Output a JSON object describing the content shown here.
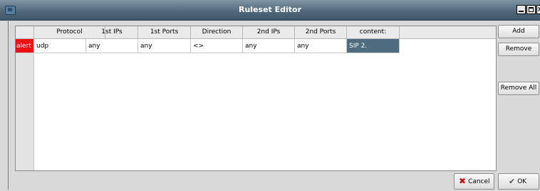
{
  "window": {
    "title": "Ruleset Editor"
  },
  "table": {
    "columns": [
      "Protocol",
      "1st IPs",
      "1st Ports",
      "Direction",
      "2nd IPs",
      "2nd Ports",
      "content:"
    ],
    "rows": [
      {
        "action": "alert",
        "protocol": "udp",
        "ips1": "any",
        "ports1": "any",
        "direction": "<>",
        "ips2": "any",
        "ports2": "any",
        "content": "SIP 2."
      }
    ]
  },
  "buttons": {
    "add": "Add",
    "remove": "Remove",
    "remove_all": "Remove All",
    "cancel": "Cancel",
    "ok": "OK"
  },
  "colors": {
    "action_cell": "#ee1111",
    "selected_cell": "#4e6b80",
    "titlebar": "#4e6678"
  },
  "icons": {
    "app": "app-icon",
    "minimize": "minimize-icon",
    "maximize": "maximize-icon",
    "close": "close-icon",
    "cancel": "cancel-x-icon",
    "ok": "ok-icon"
  }
}
